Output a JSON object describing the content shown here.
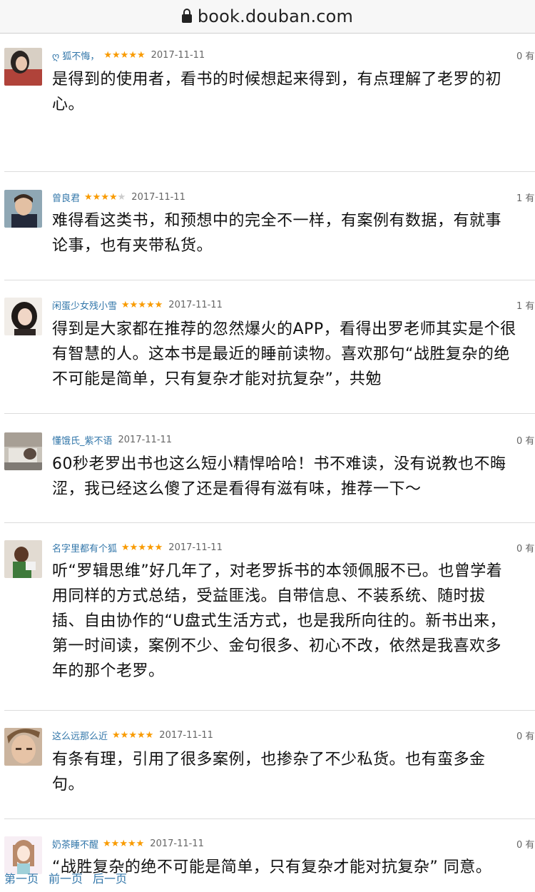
{
  "browser": {
    "url": "book.douban.com"
  },
  "reviews": [
    {
      "user": "ღ 狐不悔，",
      "stars": 5,
      "date": "2017-11-11",
      "votes": "0 有",
      "text": "是得到的使用者，看书的时候想起来得到，有点理解了老罗的初心。"
    },
    {
      "user": "曾良君",
      "stars": 4,
      "date": "2017-11-11",
      "votes": "1 有",
      "text": "难得看这类书，和预想中的完全不一样，有案例有数据，有就事论事，也有夹带私货。"
    },
    {
      "user": "闲蛋少女残小雪",
      "stars": 5,
      "date": "2017-11-11",
      "votes": "1 有",
      "text": "得到是大家都在推荐的忽然爆火的APP，看得出罗老师其实是个很有智慧的人。这本书是最近的睡前读物。喜欢那句“战胜复杂的绝不可能是简单，只有复杂才能对抗复杂”，共勉"
    },
    {
      "user": "懂饿氏_紫不语",
      "stars": 0,
      "date": "2017-11-11",
      "votes": "0 有",
      "text": "60秒老罗出书也这么短小精悍哈哈！书不难读，没有说教也不晦涩，我已经这么傻了还是看得有滋有味，推荐一下～"
    },
    {
      "user": "名字里都有个狐",
      "stars": 5,
      "date": "2017-11-11",
      "votes": "0 有",
      "text": "听“罗辑思维”好几年了，对老罗拆书的本领佩服不已。也曾学着用同样的方式总结，受益匪浅。自带信息、不装系统、随时拔插、自由协作的“U盘式生活方式，也是我所向往的。新书出来，第一时间读，案例不少、金句很多、初心不改，依然是我喜欢多年的那个老罗。"
    },
    {
      "user": "这么远那么近",
      "stars": 5,
      "date": "2017-11-11",
      "votes": "0 有",
      "text": "有条有理，引用了很多案例，也掺杂了不少私货。也有蛮多金句。"
    },
    {
      "user": "奶茶睡不醒",
      "stars": 5,
      "date": "2017-11-11",
      "votes": "0 有",
      "text": "“战胜复杂的绝不可能是简单，只有复杂才能对抗复杂” 同意。"
    }
  ],
  "pager": {
    "first": "第一页",
    "prev": "前一页",
    "next": "后一页"
  },
  "colors": {
    "link": "#3377aa",
    "star": "#f99b01",
    "separator": "#dcdcdc"
  },
  "icons": {
    "lock": "lock-icon",
    "star": "star-icon"
  }
}
